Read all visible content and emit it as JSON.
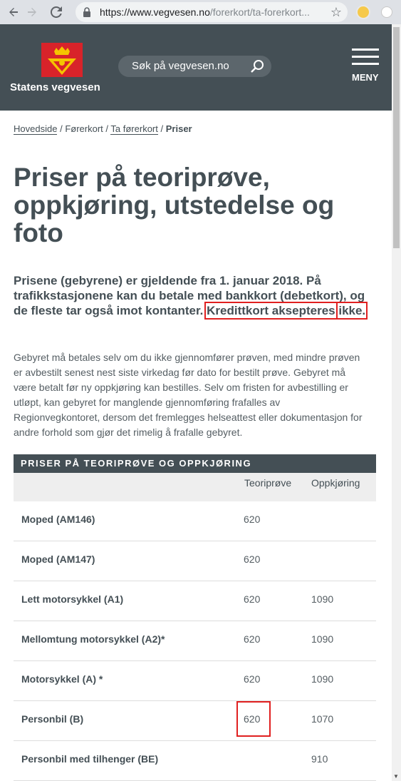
{
  "browser": {
    "url_domain": "https://www.vegvesen.no",
    "url_path": "/forerkort/ta-forerkort...",
    "back_icon": "arrow-left-icon",
    "forward_icon": "arrow-right-icon",
    "reload_icon": "reload-icon"
  },
  "header": {
    "site_name": "Statens vegvesen",
    "search_placeholder": "Søk på vegvesen.no",
    "menu_label": "MENY"
  },
  "breadcrumb": {
    "items": [
      "Hovedside",
      "Førerkort",
      "Ta førerkort"
    ],
    "current": "Priser",
    "separator": "/"
  },
  "page": {
    "title": "Priser på teoriprøve, oppkjøring, utstedelse og foto",
    "lead_part1": "Prisene (gebyrene) er gjeldende fra 1. januar 2018. På trafikkstasjonene kan du betale med bankkort (debetkort), og de fleste tar også imot kontanter.",
    "lead_hl1": "Kredittkort aksepteres",
    "lead_hl2": "ikke.",
    "body": "Gebyret må betales selv om du ikke gjennomfører prøven, med mindre prøven er avbestilt senest nest siste virkedag før dato for bestilt prøve. Gebyret må være betalt før ny oppkjøring kan bestilles. Selv om fristen for avbestilling er utløpt, kan gebyret for manglende gjennomføring frafalles av Regionvegkontoret, dersom det fremlegges helseattest eller dokumentasjon for andre forhold som gjør det rimelig å frafalle gebyret."
  },
  "table": {
    "title": "PRISER PÅ TEORIPRØVE OG OPPKJØRING",
    "headers": [
      "",
      "Teoriprøve",
      "Oppkjøring"
    ],
    "rows": [
      [
        "Moped (AM146)",
        "620",
        ""
      ],
      [
        "Moped (AM147)",
        "620",
        ""
      ],
      [
        "Lett motorsykkel (A1)",
        "620",
        "1090"
      ],
      [
        "Mellomtung motorsykkel (A2)*",
        "620",
        "1090"
      ],
      [
        "Motorsykkel (A) *",
        "620",
        "1090"
      ],
      [
        "Personbil (B)",
        "620",
        "1070"
      ],
      [
        "Personbil med tilhenger (BE)",
        "",
        "910"
      ]
    ]
  },
  "colors": {
    "header_bg": "#444f55",
    "highlight": "#e02020",
    "logo_red": "#d8232a",
    "logo_yellow": "#f5c400"
  }
}
